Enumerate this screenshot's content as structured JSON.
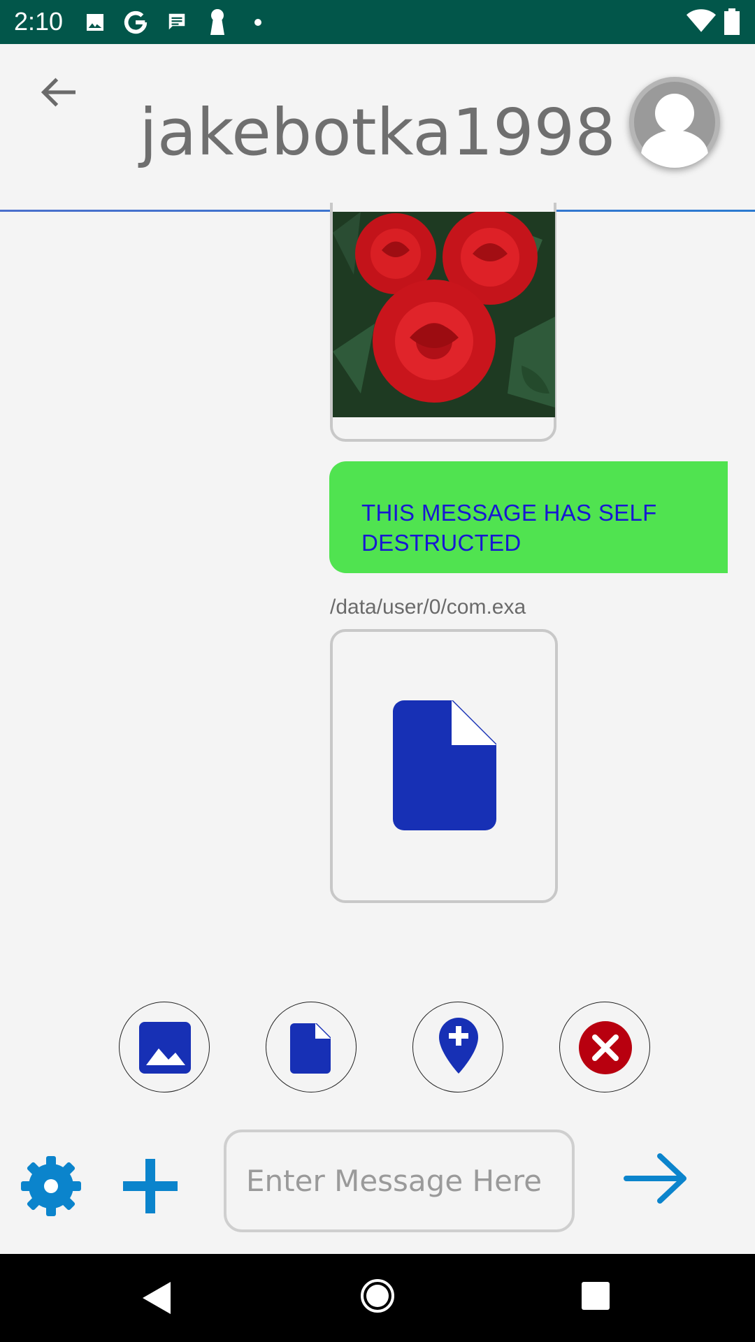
{
  "status_bar": {
    "time": "2:10",
    "icons": [
      "image-icon",
      "google-icon",
      "message-icon",
      "keyhole-icon",
      "dot-icon",
      "wifi-icon",
      "battery-icon"
    ]
  },
  "header": {
    "contact_name": "jakebotka1998",
    "back_icon": "arrow-left-icon",
    "avatar_icon": "person-icon"
  },
  "messages": [
    {
      "type": "image",
      "description_icon": "photo-icon"
    },
    {
      "type": "text",
      "text": "THIS MESSAGE HAS SELF DESTRUCTED"
    },
    {
      "type": "file",
      "path": "/data/user/0/com.exa",
      "icon": "document-icon"
    }
  ],
  "attachment_bar": [
    {
      "name": "image-attach",
      "icon": "image-icon"
    },
    {
      "name": "file-attach",
      "icon": "document-icon"
    },
    {
      "name": "location-attach",
      "icon": "add-location-icon"
    },
    {
      "name": "cancel-attach",
      "icon": "close-circle-icon"
    }
  ],
  "input_bar": {
    "placeholder": "Enter Message Here",
    "settings_icon": "gear-icon",
    "add_icon": "plus-icon",
    "send_icon": "arrow-right-icon"
  },
  "nav_bar": {
    "buttons": [
      "back-triangle-icon",
      "home-circle-icon",
      "recents-square-icon"
    ]
  },
  "colors": {
    "status_bar": "#02564a",
    "bubble": "#50e350",
    "bubble_text": "#1717d3",
    "icon_blue": "#1730b5",
    "accent_blue": "#0b84cc",
    "cancel_red": "#b8000f"
  }
}
